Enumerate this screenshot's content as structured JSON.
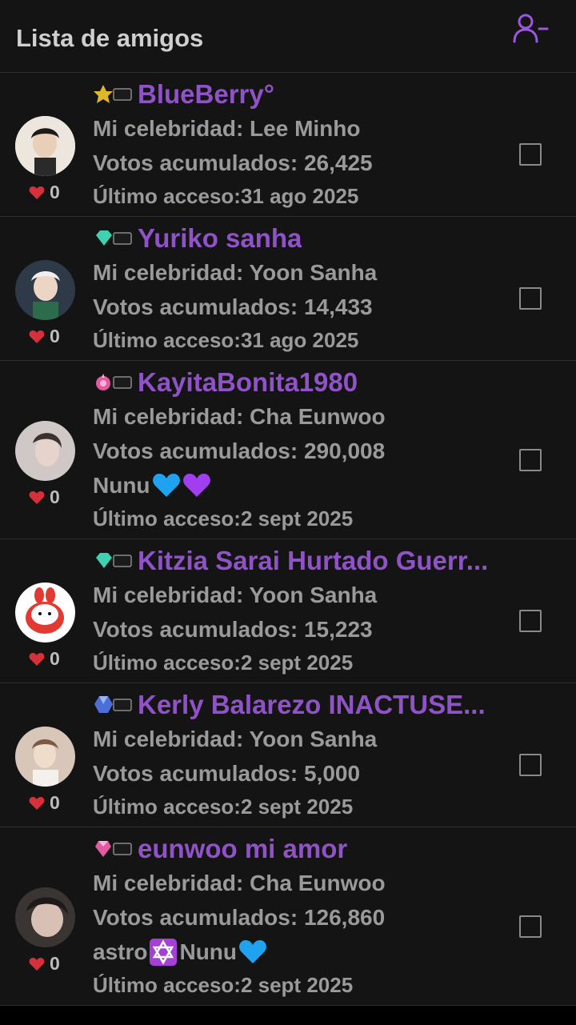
{
  "header": {
    "title": "Lista de amigos"
  },
  "friends": [
    {
      "badge_level": "8",
      "badge_color": "#e0b62d",
      "name": "BlueBerry°",
      "celebrity": "Mi celebridad: Lee Minho",
      "votes": "Votos acumulados: 26,425",
      "bio": "",
      "last_access": "Último acceso:31 ago 2025",
      "likes": "0",
      "avatar_color": "#e8e2da"
    },
    {
      "badge_level": "7",
      "badge_color": "#3fd1b0",
      "name": "Yuriko sanha",
      "celebrity": "Mi celebridad: Yoon Sanha",
      "votes": "Votos acumulados: 14,433",
      "bio": "",
      "last_access": "Último acceso:31 ago 2025",
      "likes": "0",
      "avatar_color": "#2f3a48"
    },
    {
      "badge_level": "17",
      "badge_color": "#e35aa0",
      "name": "KayitaBonita1980",
      "celebrity": "Mi celebridad: Cha Eunwoo",
      "votes": "Votos acumulados: 290,008",
      "bio": "Nunu",
      "last_access": "Último acceso:2 sept 2025",
      "likes": "0",
      "avatar_color": "#cfc8c6"
    },
    {
      "badge_level": "7",
      "badge_color": "#3fd1b0",
      "name": "Kitzia Sarai Hurtado Guerr...",
      "celebrity": "Mi celebridad: Yoon Sanha",
      "votes": "Votos acumulados: 15,223",
      "bio": "",
      "last_access": "Último acceso:2 sept 2025",
      "likes": "0",
      "avatar_color": "#ffffff"
    },
    {
      "badge_level": "5",
      "badge_color": "#4b6fd6",
      "name": "Kerly Balarezo INACTUSE...",
      "celebrity": "Mi celebridad: Yoon Sanha",
      "votes": "Votos acumulados: 5,000",
      "bio": "",
      "last_access": "Último acceso:2 sept 2025",
      "likes": "0",
      "avatar_color": "#d8c7b8"
    },
    {
      "badge_level": "14",
      "badge_color": "#e35aa0",
      "name": "eunwoo mi amor",
      "celebrity": "Mi celebridad: Cha Eunwoo",
      "votes": "Votos acumulados: 126,860",
      "bio": "astro",
      "bio_2": "Nunu",
      "last_access": "Último acceso:2 sept 2025",
      "likes": "0",
      "avatar_color": "#3a3432"
    }
  ]
}
